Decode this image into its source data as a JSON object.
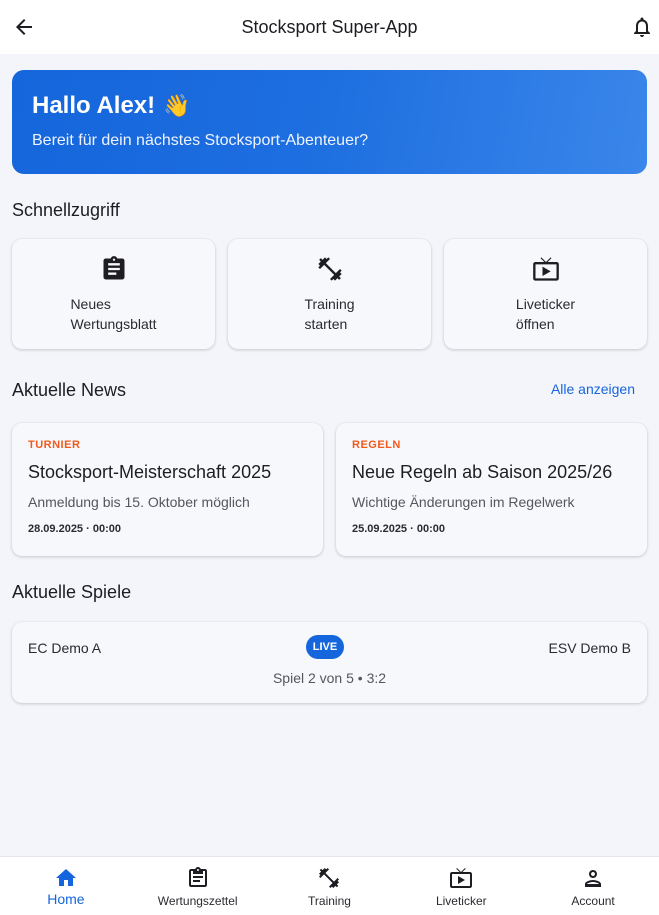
{
  "appbar": {
    "title": "Stocksport Super-App",
    "back_icon": "arrow-left-icon",
    "notification_icon": "bell-icon"
  },
  "hero": {
    "greeting": "Hallo Alex!",
    "emoji": "👋",
    "subtitle": "Bereit für dein nächstes Stocksport-Abenteuer?"
  },
  "quick_access": {
    "title": "Schnellzugriff",
    "items": [
      {
        "label_line1": "Neues",
        "label_line2": "Wertungsblatt",
        "icon": "clipboard-icon"
      },
      {
        "label_line1": "Training",
        "label_line2": "starten",
        "icon": "dumbbell-icon"
      },
      {
        "label_line1": "Liveticker",
        "label_line2": "öffnen",
        "icon": "live-tv-icon"
      }
    ]
  },
  "news": {
    "title": "Aktuelle News",
    "show_all": "Alle anzeigen",
    "items": [
      {
        "tag": "TURNIER",
        "headline": "Stocksport-Meisterschaft 2025",
        "desc": "Anmeldung bis 15. Oktober möglich",
        "date": "28.09.2025 · 00:00"
      },
      {
        "tag": "REGELN",
        "headline": "Neue Regeln ab Saison 2025/26",
        "desc": "Wichtige Änderungen im Regelwerk",
        "date": "25.09.2025 · 00:00"
      }
    ]
  },
  "games": {
    "title": "Aktuelle Spiele",
    "items": [
      {
        "team_a": "EC Demo A",
        "team_b": "ESV Demo B",
        "status": "LIVE",
        "score": "Spiel 2 von 5 • 3:2"
      }
    ]
  },
  "bottom_nav": {
    "items": [
      {
        "label": "Home",
        "icon": "home-icon",
        "active": true
      },
      {
        "label": "Wertungszettel",
        "icon": "clipboard-icon",
        "active": false
      },
      {
        "label": "Training",
        "icon": "dumbbell-icon",
        "active": false
      },
      {
        "label": "Liveticker",
        "icon": "live-tv-icon",
        "active": false
      },
      {
        "label": "Account",
        "icon": "person-icon",
        "active": false
      }
    ]
  },
  "colors": {
    "primary": "#1565dc",
    "tag_accent": "#f05a1a",
    "background": "#f4f5fa"
  }
}
